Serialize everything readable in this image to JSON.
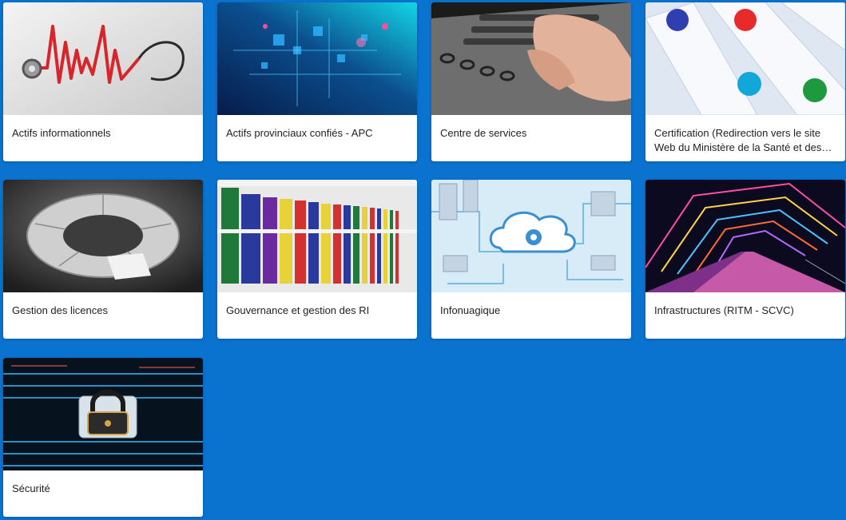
{
  "colors": {
    "page_background": "#0a73cf",
    "card_background": "#ffffff"
  },
  "tiles": [
    {
      "title": "Actifs informationnels",
      "image": "stethoscope-heartbeat-image"
    },
    {
      "title": "Actifs provinciaux confiés - APC",
      "image": "digital-network-image"
    },
    {
      "title": "Centre de services",
      "image": "hands-typing-keyboard-image"
    },
    {
      "title": "Certification (Redirection vers le site Web du Ministère de la Santé et des Services sociaux)",
      "image": "certification-pins-image"
    },
    {
      "title": "Gestion des licences",
      "image": "puzzle-ring-image"
    },
    {
      "title": "Gouvernance et gestion des RI",
      "image": "binders-shelf-image"
    },
    {
      "title": "Infonuagique",
      "image": "cloud-computing-image"
    },
    {
      "title": "Infrastructures (RITM - SCVC)",
      "image": "neon-bridge-tunnel-image"
    },
    {
      "title": "Sécurité",
      "image": "padlock-circuit-image"
    }
  ]
}
